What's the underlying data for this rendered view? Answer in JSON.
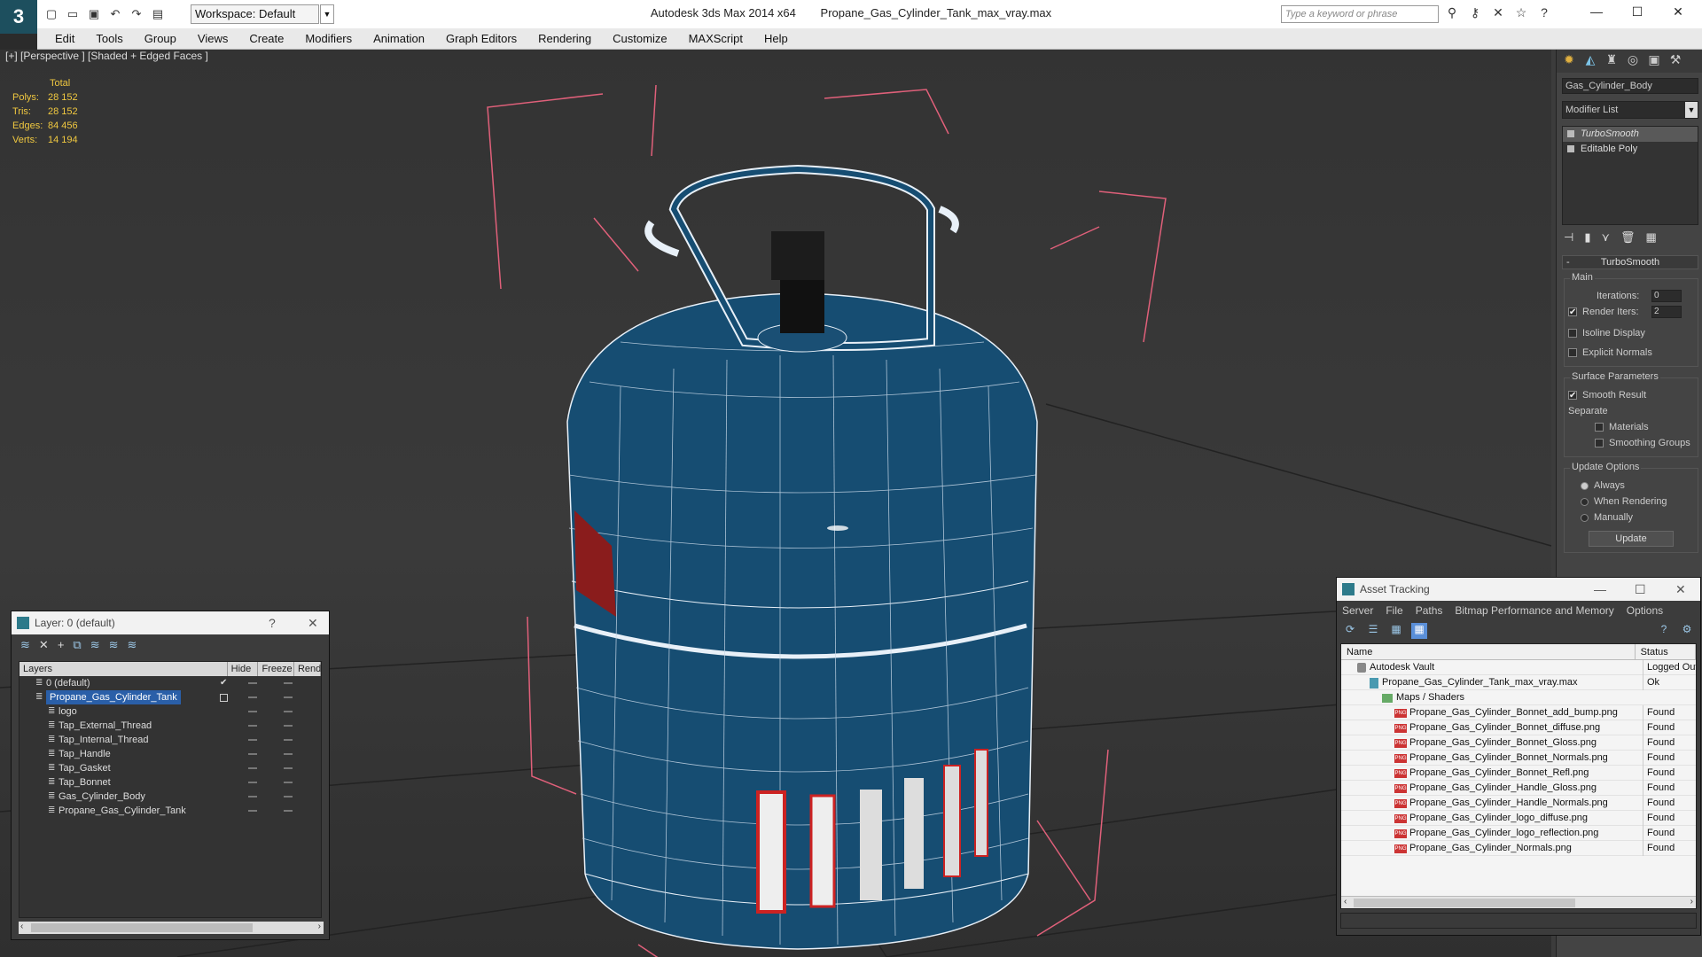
{
  "app": {
    "logo": "3",
    "title": "Autodesk 3ds Max  2014 x64",
    "file": "Propane_Gas_Cylinder_Tank_max_vray.max",
    "workspace": "Workspace: Default",
    "search_placeholder": "Type a keyword or phrase"
  },
  "menu": [
    "Edit",
    "Tools",
    "Group",
    "Views",
    "Create",
    "Modifiers",
    "Animation",
    "Graph Editors",
    "Rendering",
    "Customize",
    "MAXScript",
    "Help"
  ],
  "viewport": {
    "label": "[+] [Perspective ] [Shaded + Edged Faces ]",
    "stats": {
      "header": "Total",
      "rows": [
        {
          "k": "Polys:",
          "v": "28 152"
        },
        {
          "k": "Tris:",
          "v": "28 152"
        },
        {
          "k": "Edges:",
          "v": "84 456"
        },
        {
          "k": "Verts:",
          "v": "14 194"
        }
      ]
    }
  },
  "command_panel": {
    "object_name": "Gas_Cylinder_Body",
    "modifier_list": "Modifier List",
    "stack": [
      "TurboSmooth",
      "Editable Poly"
    ],
    "rollout": "TurboSmooth",
    "main_group": "Main",
    "iterations_label": "Iterations:",
    "iterations": "0",
    "render_iters_label": "Render Iters:",
    "render_iters": "2",
    "isoline": "Isoline Display",
    "explicit_normals": "Explicit Normals",
    "surface_group": "Surface Parameters",
    "smooth_result": "Smooth Result",
    "separate": "Separate",
    "materials": "Materials",
    "smoothing_groups": "Smoothing Groups",
    "update_group": "Update Options",
    "always": "Always",
    "when_rendering": "When Rendering",
    "manually": "Manually",
    "update_btn": "Update"
  },
  "layer_panel": {
    "title": "Layer: 0 (default)",
    "help": "?",
    "close": "✕",
    "columns": [
      "Layers",
      "Hide",
      "Freeze",
      "Rend"
    ],
    "rows": [
      {
        "name": "0 (default)",
        "indent": 0
      },
      {
        "name": "Propane_Gas_Cylinder_Tank",
        "indent": 0,
        "selected": true
      },
      {
        "name": "logo",
        "indent": 1
      },
      {
        "name": "Tap_External_Thread",
        "indent": 1
      },
      {
        "name": "Tap_Internal_Thread",
        "indent": 1
      },
      {
        "name": "Tap_Handle",
        "indent": 1
      },
      {
        "name": "Tap_Gasket",
        "indent": 1
      },
      {
        "name": "Tap_Bonnet",
        "indent": 1
      },
      {
        "name": "Gas_Cylinder_Body",
        "indent": 1
      },
      {
        "name": "Propane_Gas_Cylinder_Tank",
        "indent": 1
      }
    ]
  },
  "asset_panel": {
    "title": "Asset Tracking",
    "menu": [
      "Server",
      "File",
      "Paths",
      "Bitmap Performance and Memory",
      "Options"
    ],
    "columns": [
      "Name",
      "Status"
    ],
    "rows": [
      {
        "name": "Autodesk Vault",
        "status": "Logged Out",
        "type": "vault",
        "indent": 0
      },
      {
        "name": "Propane_Gas_Cylinder_Tank_max_vray.max",
        "status": "Ok",
        "type": "max",
        "indent": 1
      },
      {
        "name": "Maps / Shaders",
        "status": "",
        "type": "folder",
        "indent": 2
      },
      {
        "name": "Propane_Gas_Cylinder_Bonnet_add_bump.png",
        "status": "Found",
        "type": "png",
        "indent": 3
      },
      {
        "name": "Propane_Gas_Cylinder_Bonnet_diffuse.png",
        "status": "Found",
        "type": "png",
        "indent": 3
      },
      {
        "name": "Propane_Gas_Cylinder_Bonnet_Gloss.png",
        "status": "Found",
        "type": "png",
        "indent": 3
      },
      {
        "name": "Propane_Gas_Cylinder_Bonnet_Normals.png",
        "status": "Found",
        "type": "png",
        "indent": 3
      },
      {
        "name": "Propane_Gas_Cylinder_Bonnet_Refl.png",
        "status": "Found",
        "type": "png",
        "indent": 3
      },
      {
        "name": "Propane_Gas_Cylinder_Handle_Gloss.png",
        "status": "Found",
        "type": "png",
        "indent": 3
      },
      {
        "name": "Propane_Gas_Cylinder_Handle_Normals.png",
        "status": "Found",
        "type": "png",
        "indent": 3
      },
      {
        "name": "Propane_Gas_Cylinder_logo_diffuse.png",
        "status": "Found",
        "type": "png",
        "indent": 3
      },
      {
        "name": "Propane_Gas_Cylinder_logo_reflection.png",
        "status": "Found",
        "type": "png",
        "indent": 3
      },
      {
        "name": "Propane_Gas_Cylinder_Normals.png",
        "status": "Found",
        "type": "png",
        "indent": 3
      }
    ]
  }
}
